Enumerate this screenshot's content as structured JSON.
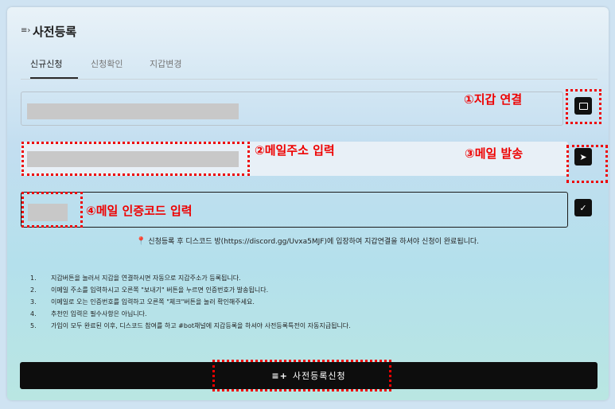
{
  "header": {
    "icon": "list-icon",
    "title": "사전등록"
  },
  "tabs": [
    {
      "label": "신규신청",
      "active": true
    },
    {
      "label": "신청확인",
      "active": false
    },
    {
      "label": "지갑변경",
      "active": false
    }
  ],
  "buttons": {
    "wallet_icon": "wallet-icon",
    "send_icon": "send-icon",
    "check_icon": "check-icon",
    "send_glyph": "➤",
    "check_glyph": "✓"
  },
  "annotations": {
    "wallet": "①지갑 연결",
    "email": "②메일주소 입력",
    "send": "③메일 발송",
    "code": "④메일 인증코드 입력"
  },
  "notice": {
    "pin_icon": "pin-icon",
    "text": "신청등록 후 디스코드 방(https://discord.gg/Uvxa5MJF)에 입장하여 지갑연결을 하셔야 신청이 완료됩니다."
  },
  "instructions": [
    {
      "num": "1.",
      "text": "지갑버튼을 눌러서 지갑을 연결하시면 자동으로 지갑주소가 등록됩니다."
    },
    {
      "num": "2.",
      "text": "이메일 주소를 입력하시고 오른쪽 \"보내기\" 버튼을 누르면 인증번호가 발송됩니다."
    },
    {
      "num": "3.",
      "text": "이메일로 오는 인증번호를 입력하고 오른쪽 \"체크\"버튼을 눌러 확인해주세요."
    },
    {
      "num": "4.",
      "text": "추천인 입력은 필수사항은 아닙니다."
    },
    {
      "num": "5.",
      "text": "가입이 모두 완료된 이후, 디스코드 참여를 하고 #bot채널에 지갑등록을 하셔야 사전등록특전이 자동지급됩니다."
    }
  ],
  "submit": {
    "icon": "list-add-icon",
    "icon_glyph": "≡+",
    "label": "사전등록신청"
  }
}
